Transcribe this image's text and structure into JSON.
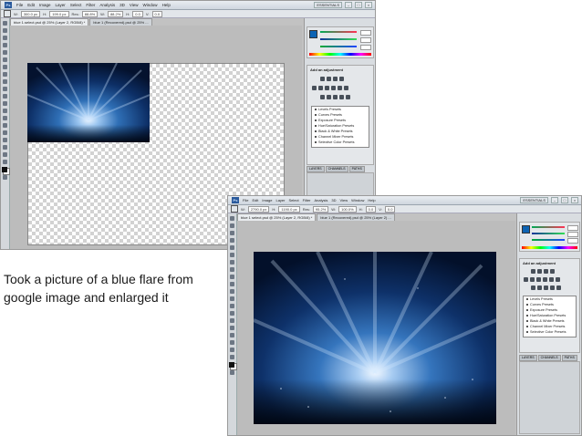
{
  "caption": "Took a picture of a blue flare from google image and enlarged it",
  "ps": {
    "logo": "Ps",
    "menu": [
      "File",
      "Edit",
      "Image",
      "Layer",
      "Select",
      "Filter",
      "Analysis",
      "3D",
      "View",
      "Window",
      "Help"
    ],
    "workspace": "ESSENTIALS",
    "win_min": "–",
    "win_max": "□",
    "win_close": "×"
  },
  "screenshot1": {
    "options": [
      "W:",
      "300.0 px",
      "H:",
      "199.0 px",
      "Res:",
      "88.8%",
      "W:",
      "88.2%",
      "H:",
      "0.0",
      "V:",
      "0.0"
    ],
    "doc_tab_active": "blue 1.select.psd @ 25% (Layer 2, RGB/8) *",
    "doc_tab_other": "blue 1 (Recovered).psd @ 25% ...",
    "panel_tabs": [
      "COLOR",
      "SWATCHES",
      "STYLES"
    ],
    "adj_tabs": [
      "ADJUSTMENTS",
      "MASKS"
    ],
    "adj_title": "Add an adjustment",
    "presets": [
      "Levels Presets",
      "Curves Presets",
      "Exposure Presets",
      "Hue/Saturation Presets",
      "Black & White Presets",
      "Channel Mixer Presets",
      "Selective Color Presets"
    ],
    "layer_tabs": [
      "LAYERS",
      "CHANNELS",
      "PATHS"
    ]
  },
  "screenshot2": {
    "options": [
      "W:",
      "2790.0 px",
      "H:",
      "1190.0 px",
      "Res:",
      "95.2%",
      "W:",
      "100.0%",
      "H:",
      "0.0",
      "V:",
      "0.0"
    ],
    "doc_tab_active": "blue 1 select.psd @ 25% (Layer 2, RGB/8) *",
    "doc_tab_other": "blue 1 (Recovered).psd @ 25% (Layer 2) ...",
    "panel_tabs": [
      "COLOR",
      "SWATCHES",
      "STYLES"
    ],
    "adj_tabs": [
      "ADJUSTMENTS",
      "MASKS"
    ],
    "adj_title": "Add an adjustment",
    "presets": [
      "Levels Presets",
      "Curves Presets",
      "Exposure Presets",
      "Hue/Saturation Presets",
      "Black & White Presets",
      "Channel Mixer Presets",
      "Selective Color Presets"
    ],
    "layer_tabs": [
      "LAYERS",
      "CHANNELS",
      "PATHS"
    ]
  }
}
